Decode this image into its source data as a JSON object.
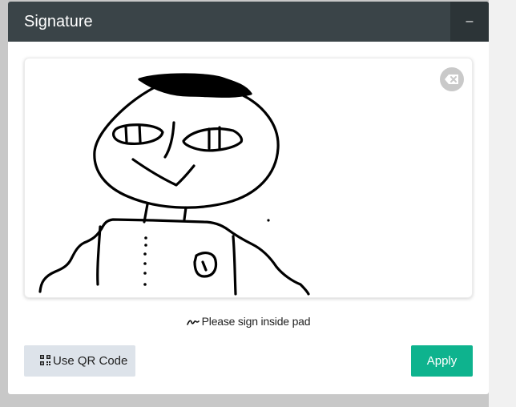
{
  "panel": {
    "title": "Signature",
    "collapse_label": "–"
  },
  "signature_pad": {
    "clear_icon": "eraser-icon",
    "hint_icon": "signature-icon",
    "hint": "Please sign inside pad"
  },
  "actions": {
    "qr_label": "Use QR Code",
    "qr_icon": "qr-code-icon",
    "apply_label": "Apply"
  },
  "colors": {
    "header": "#3a4448",
    "apply": "#0eb38e",
    "qr_button": "#dde3ea"
  }
}
